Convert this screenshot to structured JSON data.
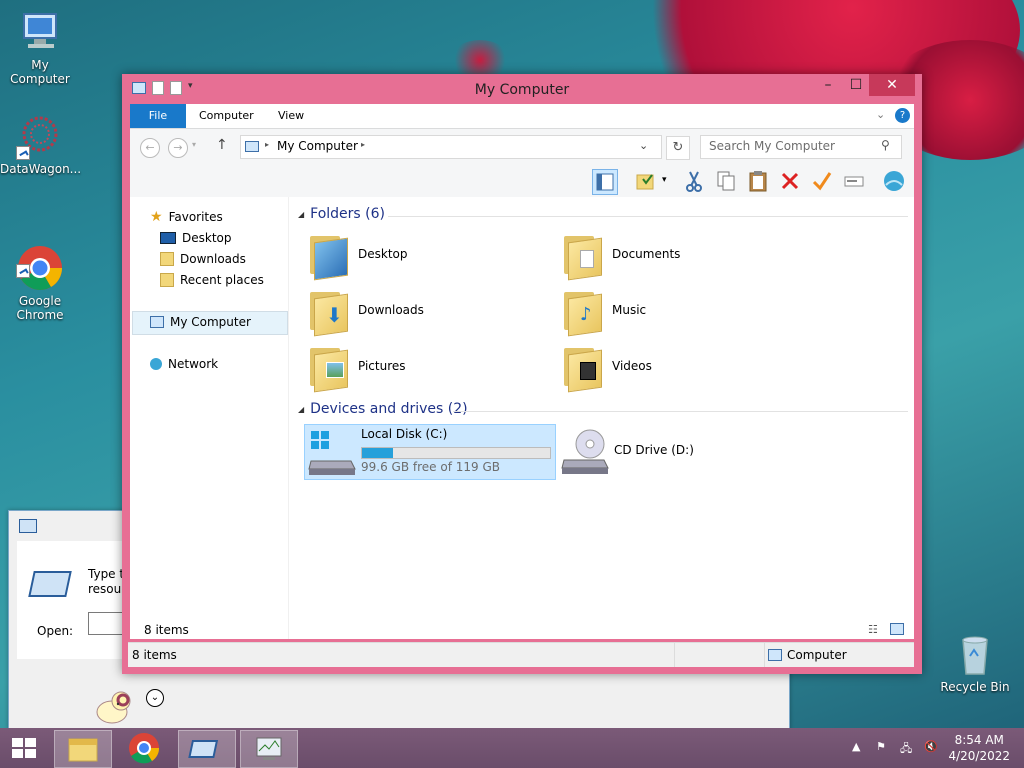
{
  "desktop": {
    "icons": [
      {
        "label": "My Computer"
      },
      {
        "label": "DataWagon..."
      },
      {
        "label": "Google\nChrome"
      },
      {
        "label": "Recycle Bin"
      }
    ]
  },
  "run_dialog": {
    "prompt": "Type the\nresource",
    "open_label": "Open:"
  },
  "window": {
    "title": "My Computer",
    "ribbon_tabs": [
      "File",
      "Computer",
      "View"
    ],
    "address": "My Computer",
    "search_placeholder": "Search My Computer",
    "nav": {
      "favorites": "Favorites",
      "desktop": "Desktop",
      "downloads": "Downloads",
      "recent": "Recent places",
      "my_computer": "My Computer",
      "network": "Network"
    },
    "folders_header": "Folders (6)",
    "folders": [
      "Desktop",
      "Documents",
      "Downloads",
      "Music",
      "Pictures",
      "Videos"
    ],
    "drives_header": "Devices and drives (2)",
    "drives": [
      {
        "name": "Local Disk (C:)",
        "free": "99.6 GB free of 119 GB",
        "used_fraction": 0.163
      },
      {
        "name": "CD Drive (D:)"
      }
    ],
    "item_count": "8 items",
    "status_count": "8 items",
    "status_location": "Computer"
  },
  "taskbar": {
    "time": "8:54 AM",
    "date": "4/20/2022"
  },
  "colors": {
    "window_frame": "#e76f94",
    "accent": "#1979ca",
    "group_header": "#1e3287",
    "selection": "#cce8ff"
  }
}
